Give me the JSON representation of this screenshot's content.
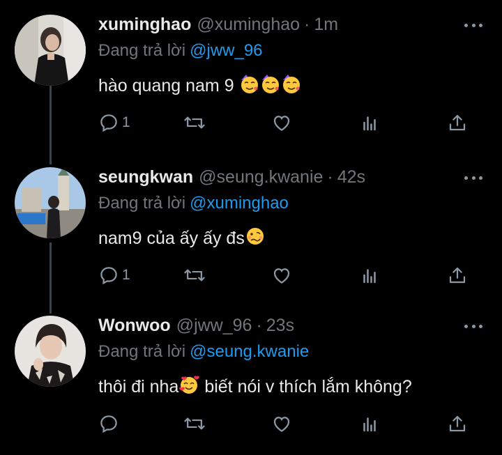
{
  "tweets": [
    {
      "name": "xuminghao",
      "handle": "@xuminghao",
      "time": "1m",
      "reply_prefix": "Đang trả lời",
      "reply_to": "@jww_96",
      "text": "hào quang nam 9",
      "emojis": [
        "partying-face-emoji",
        "partying-face-emoji",
        "partying-face-emoji"
      ],
      "reply_count": "1",
      "retweet_count": "",
      "like_count": ""
    },
    {
      "name": "seungkwan",
      "handle": "@seung.kwanie",
      "time": "42s",
      "reply_prefix": "Đang trả lời",
      "reply_to": "@xuminghao",
      "text": "nam9 của ấy ấy đs",
      "emojis": [
        "woozy-face-emoji"
      ],
      "reply_count": "1",
      "retweet_count": "",
      "like_count": ""
    },
    {
      "name": "Wonwoo",
      "handle": "@jww_96",
      "time": "23s",
      "reply_prefix": "Đang trả lời",
      "reply_to": "@seung.kwanie",
      "text_before": "thôi đi nha",
      "text_after": " biết nói v thích lắm không?",
      "emojis": [
        "smiling-face-with-hearts-emoji"
      ],
      "reply_count": "",
      "retweet_count": "",
      "like_count": ""
    }
  ],
  "separator": "·",
  "colors": {
    "background": "#000000",
    "primary_text": "#e7e9ea",
    "secondary_text": "#71767b",
    "mention": "#1d9bf0",
    "thread_line": "#38444d",
    "icon": "#8b98a5"
  }
}
